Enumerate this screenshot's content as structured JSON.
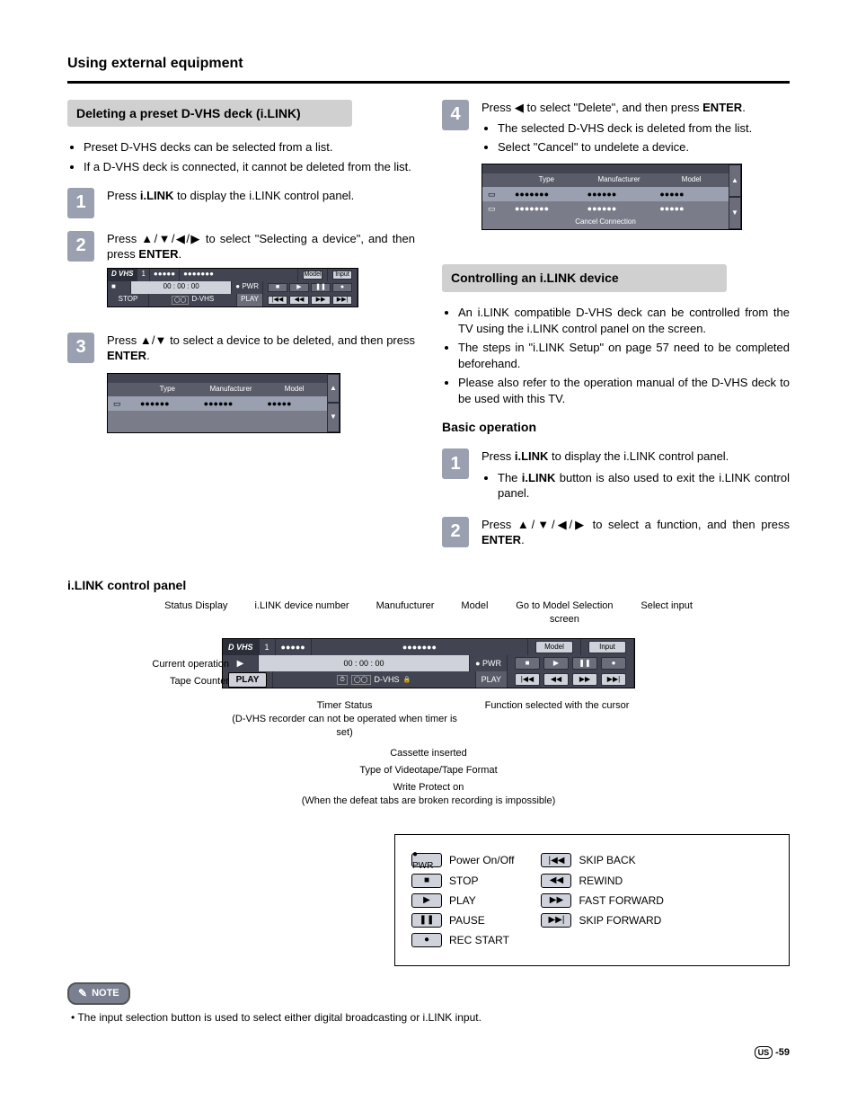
{
  "page_title": "Using external equipment",
  "left": {
    "section": "Deleting a preset D-VHS deck (i.LINK)",
    "intro_bullets": [
      "Preset D-VHS decks can be selected from a list.",
      "If a D-VHS deck is connected, it cannot be deleted from the list."
    ],
    "step1": {
      "num": "1",
      "text_before": "Press ",
      "kw": "i.LINK",
      "text_after": " to display the i.LINK control panel."
    },
    "step2": {
      "num": "2",
      "text_a": "Press ",
      "arrows": "▲/▼/◀/▶",
      "text_b": " to select \"Selecting a device\", and then press ",
      "enter": "ENTER",
      "text_c": "."
    },
    "step2_panel": {
      "dvhs_logo": "D VHS",
      "dev_num": "1",
      "dots1": "●●●●●",
      "dots2": "●●●●●●●",
      "model_btn": "Model",
      "input_btn": "Input",
      "counter": "00 : 00 : 00",
      "pwr": "● PWR",
      "dvhs_text": "D-VHS",
      "stop_label": "STOP",
      "play_label": "PLAY",
      "icons": {
        "skipb": "|◀◀",
        "rew": "◀◀",
        "ff": "▶▶",
        "skipf": "▶▶|"
      }
    },
    "step3": {
      "num": "3",
      "text_a": "Press ",
      "arrows": "▲/▼",
      "text_b": " to select a device to be deleted, and then press ",
      "enter": "ENTER",
      "text_c": "."
    },
    "step3_panel": {
      "headers": {
        "type": "Type",
        "man": "Manufacturer",
        "model": "Model"
      },
      "row": {
        "type": "●●●●●●",
        "man": "●●●●●●",
        "model": "●●●●●"
      }
    }
  },
  "right": {
    "step4": {
      "num": "4",
      "text_a": "Press ",
      "arrow": "◀",
      "text_b": " to select \"Delete\", and then press ",
      "enter": "ENTER",
      "text_c": ".",
      "subs": [
        "The selected D-VHS deck is deleted from the list.",
        "Select \"Cancel\" to undelete a device."
      ]
    },
    "step4_panel": {
      "headers": {
        "type": "Type",
        "man": "Manufacturer",
        "model": "Model"
      },
      "rows": [
        {
          "type": "●●●●●●●",
          "man": "●●●●●●",
          "model": "●●●●●"
        },
        {
          "type": "●●●●●●●",
          "man": "●●●●●●",
          "model": "●●●●●"
        }
      ],
      "cancel": "Cancel Connection"
    },
    "section2": "Controlling an i.LINK device",
    "section2_bullets": [
      "An i.LINK compatible D-VHS deck can be controlled from the TV using the i.LINK control panel on the screen.",
      "The steps in \"i.LINK Setup\" on page 57 need to be completed beforehand.",
      "Please also refer to the operation manual of the D-VHS deck to be used with this TV."
    ],
    "basic_op": "Basic operation",
    "bo_step1": {
      "num": "1",
      "text_before": "Press ",
      "kw": "i.LINK",
      "text_after": " to display the i.LINK control panel.",
      "sub": "The ",
      "sub_kw": "i.LINK",
      "sub_after": " button is also used to exit the i.LINK control panel."
    },
    "bo_step2": {
      "num": "2",
      "text_a": "Press ",
      "arrows": "▲/▼/◀/▶",
      "text_b": " to select a function, and then press ",
      "enter": "ENTER",
      "text_c": "."
    }
  },
  "cp_section": {
    "heading": "i.LINK control panel",
    "top_labels": {
      "status": "Status Display",
      "device": "i.LINK device number",
      "manuf": "Manufucturer",
      "model": "Model",
      "goto": "Go to Model Selection screen",
      "input": "Select input"
    },
    "panel": {
      "dvhs_logo": "D VHS",
      "dev_num": "1",
      "dots1": "●●●●●",
      "dots2": "●●●●●●●",
      "model_btn": "Model",
      "input_btn": "Input",
      "counter": "00 : 00 : 00",
      "pwr": "● PWR",
      "play_btn": "PLAY",
      "dvhs_text": "D-VHS",
      "play_small": "PLAY",
      "icons": {
        "stop": "■",
        "play": "▶",
        "pause": "❚❚",
        "rec": "●",
        "skipb": "|◀◀",
        "rew": "◀◀",
        "ff": "▶▶",
        "skipf": "▶▶|"
      }
    },
    "left_callouts": {
      "cur_op": "Current operation",
      "counter": "Tape Counter"
    },
    "mid_callouts": {
      "timer": "Timer Status\n(D-VHS recorder can not be operated when timer is set)",
      "func": "Function selected with the cursor",
      "cassette": "Cassette inserted",
      "format": "Type of Videotape/Tape Format",
      "wp": "Write Protect on\n(When the defeat tabs are broken recording is impossible)"
    },
    "legend": {
      "pwr": "Power On/Off",
      "stop": "STOP",
      "play": "PLAY",
      "pause": "PAUSE",
      "rec": "REC START",
      "skipb": "SKIP BACK",
      "rew": "REWIND",
      "ff": "FAST FORWARD",
      "skipf": "SKIP FORWARD",
      "g": {
        "pwr": "● PWR",
        "stop": "■",
        "play": "▶",
        "pause": "❚❚",
        "rec": "●",
        "skipb": "|◀◀",
        "rew": "◀◀",
        "ff": "▶▶",
        "skipf": "▶▶|"
      }
    }
  },
  "note": {
    "badge": "NOTE",
    "text": "The input selection button is used to select either digital broadcasting or i.LINK input."
  },
  "page_num": {
    "us": "US",
    "num": "-59"
  }
}
